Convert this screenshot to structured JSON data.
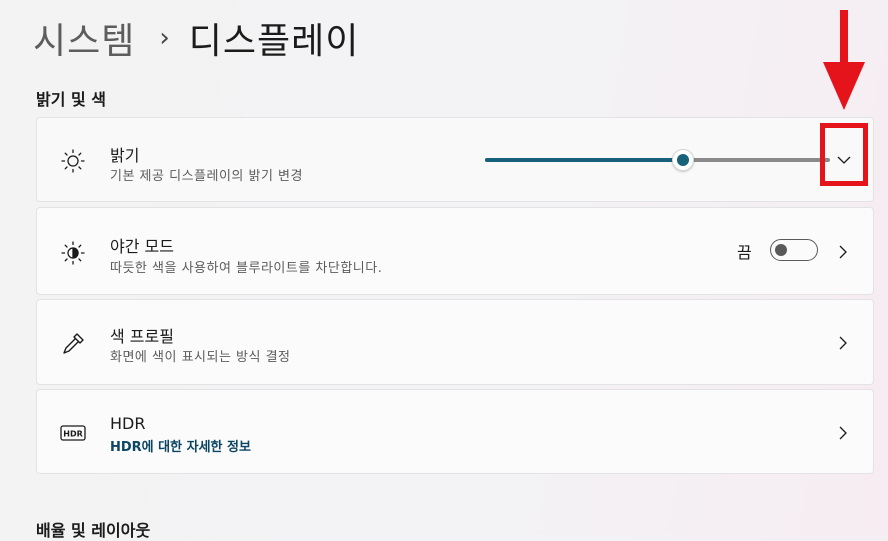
{
  "breadcrumb": {
    "parent": "시스템",
    "separator": "›",
    "current": "디스플레이"
  },
  "sections": {
    "brightness_color": "밝기 및 색",
    "scale_layout": "배율 및 레이아웃"
  },
  "brightness": {
    "title": "밝기",
    "subtitle": "기본 제공 디스플레이의 밝기 변경",
    "level_fraction": 0.575,
    "icon": "sun-icon"
  },
  "night_mode": {
    "title": "야간 모드",
    "subtitle": "따듯한 색을 사용하여 블루라이트를 차단합니다.",
    "state_label": "끔",
    "enabled": false,
    "icon": "night-light-icon"
  },
  "color_profile": {
    "title": "색 프로필",
    "subtitle": "화면에 색이 표시되는 방식 결정",
    "icon": "eyedropper-icon"
  },
  "hdr": {
    "title": "HDR",
    "subtitle": "HDR에 대한 자세한 정보",
    "icon": "hdr-icon",
    "icon_text": "HDR"
  },
  "colors": {
    "accent": "#17627a",
    "annotation": "#e5141b",
    "link": "#0c4563"
  }
}
